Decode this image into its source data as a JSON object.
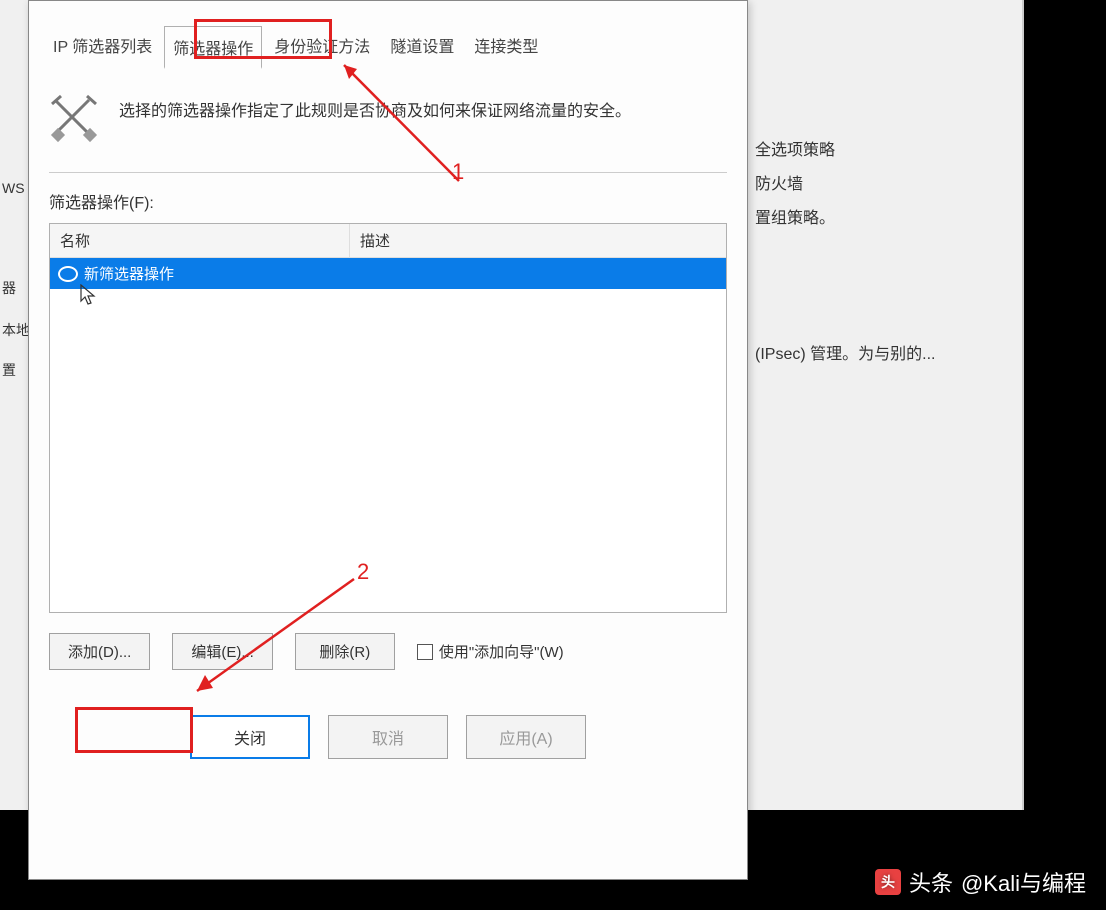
{
  "tabs": {
    "t0": "IP 筛选器列表",
    "t1": "筛选器操作",
    "t2": "身份验证方法",
    "t3": "隧道设置",
    "t4": "连接类型"
  },
  "description": "选择的筛选器操作指定了此规则是否协商及如何来保证网络流量的安全。",
  "list_label": "筛选器操作(F):",
  "columns": {
    "name": "名称",
    "desc": "描述"
  },
  "rows": {
    "r0": "新筛选器操作"
  },
  "buttons": {
    "add": "添加(D)...",
    "edit": "编辑(E)...",
    "remove": "删除(R)"
  },
  "checkbox_label": "使用\"添加向导\"(W)",
  "bottom": {
    "close": "关闭",
    "cancel": "取消",
    "apply": "应用(A)"
  },
  "bg": {
    "b1": "全选项策略",
    "b2": "防火墙",
    "b3": "置组策略。",
    "b4": "(IPsec) 管理。为与别的...",
    "l1": "WS",
    "l2": "器",
    "l3": "本地",
    "l4": "置"
  },
  "annotations": {
    "a1": "1",
    "a2": "2"
  },
  "watermark": {
    "prefix": "头条",
    "handle": "@Kali与编程"
  }
}
